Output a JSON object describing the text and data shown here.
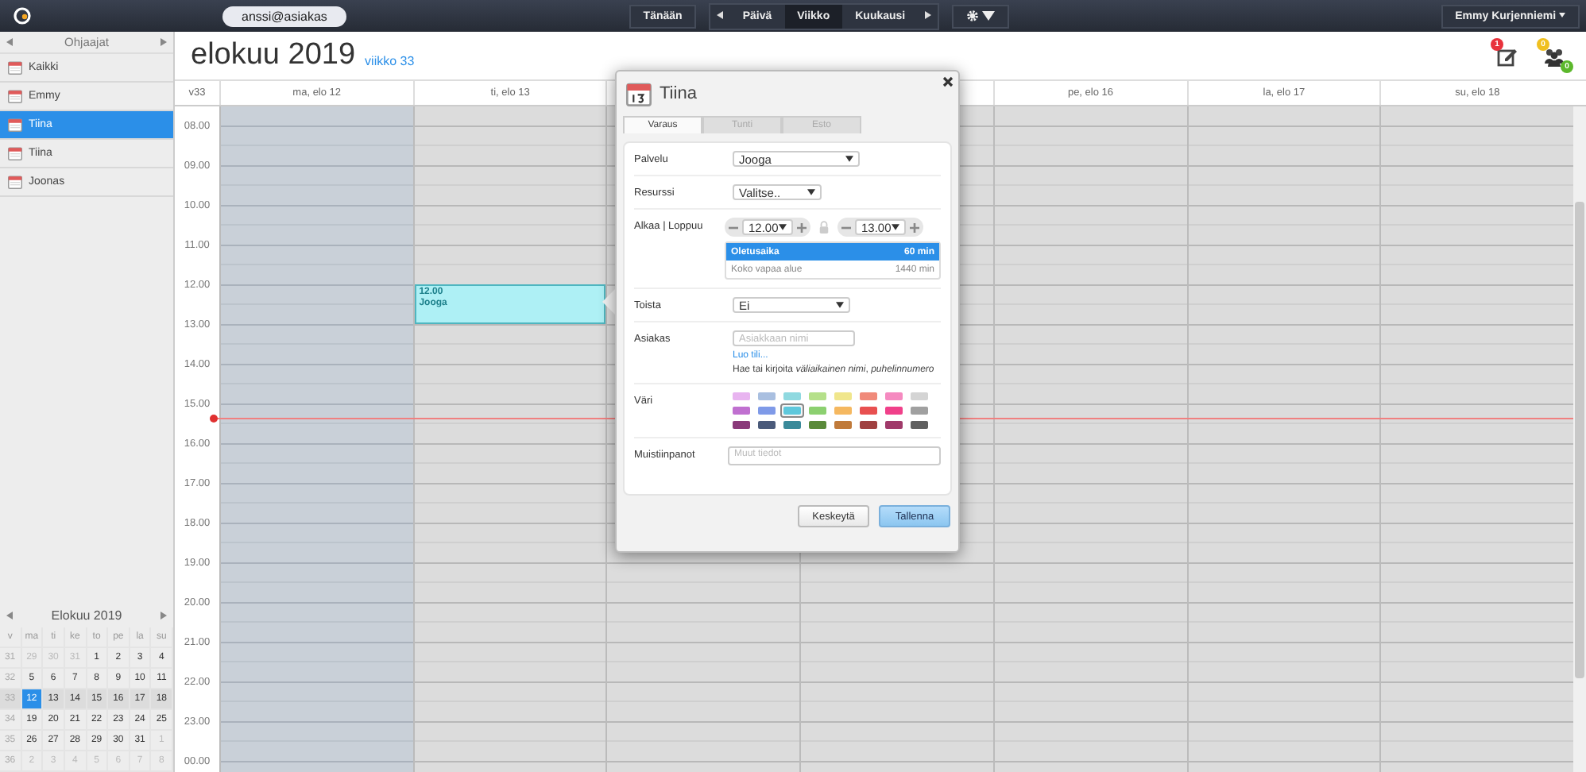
{
  "topbar": {
    "account": "anssi@asiakas",
    "today_button": "Tänään",
    "views": [
      {
        "label": "Päivä",
        "selected": false
      },
      {
        "label": "Viikko",
        "selected": true
      },
      {
        "label": "Kuukausi",
        "selected": false
      }
    ],
    "user_menu": "Emmy Kurjenniemi"
  },
  "sidebar": {
    "title": "Ohjaajat",
    "items": [
      {
        "label": "Kaikki",
        "selected": false
      },
      {
        "label": "Emmy",
        "selected": false
      },
      {
        "label": "Tiina",
        "selected": true
      },
      {
        "label": "Tiina",
        "selected": false
      },
      {
        "label": "Joonas",
        "selected": false
      }
    ]
  },
  "mini_calendar": {
    "title": "Elokuu 2019",
    "weekdays": [
      "v",
      "ma",
      "ti",
      "ke",
      "to",
      "pe",
      "la",
      "su"
    ],
    "weeks": [
      {
        "number": "31",
        "current": false,
        "days": [
          {
            "label": "29",
            "other_month": true,
            "selected": false
          },
          {
            "label": "30",
            "other_month": true,
            "selected": false
          },
          {
            "label": "31",
            "other_month": true,
            "selected": false
          },
          {
            "label": "1",
            "other_month": false,
            "selected": false
          },
          {
            "label": "2",
            "other_month": false,
            "selected": false
          },
          {
            "label": "3",
            "other_month": false,
            "selected": false
          },
          {
            "label": "4",
            "other_month": false,
            "selected": false
          }
        ]
      },
      {
        "number": "32",
        "current": false,
        "days": [
          {
            "label": "5",
            "other_month": false,
            "selected": false
          },
          {
            "label": "6",
            "other_month": false,
            "selected": false
          },
          {
            "label": "7",
            "other_month": false,
            "selected": false
          },
          {
            "label": "8",
            "other_month": false,
            "selected": false
          },
          {
            "label": "9",
            "other_month": false,
            "selected": false
          },
          {
            "label": "10",
            "other_month": false,
            "selected": false
          },
          {
            "label": "11",
            "other_month": false,
            "selected": false
          }
        ]
      },
      {
        "number": "33",
        "current": true,
        "days": [
          {
            "label": "12",
            "other_month": false,
            "selected": true
          },
          {
            "label": "13",
            "other_month": false,
            "selected": false
          },
          {
            "label": "14",
            "other_month": false,
            "selected": false
          },
          {
            "label": "15",
            "other_month": false,
            "selected": false
          },
          {
            "label": "16",
            "other_month": false,
            "selected": false
          },
          {
            "label": "17",
            "other_month": false,
            "selected": false
          },
          {
            "label": "18",
            "other_month": false,
            "selected": false
          }
        ]
      },
      {
        "number": "34",
        "current": false,
        "days": [
          {
            "label": "19",
            "other_month": false,
            "selected": false
          },
          {
            "label": "20",
            "other_month": false,
            "selected": false
          },
          {
            "label": "21",
            "other_month": false,
            "selected": false
          },
          {
            "label": "22",
            "other_month": false,
            "selected": false
          },
          {
            "label": "23",
            "other_month": false,
            "selected": false
          },
          {
            "label": "24",
            "other_month": false,
            "selected": false
          },
          {
            "label": "25",
            "other_month": false,
            "selected": false
          }
        ]
      },
      {
        "number": "35",
        "current": false,
        "days": [
          {
            "label": "26",
            "other_month": false,
            "selected": false
          },
          {
            "label": "27",
            "other_month": false,
            "selected": false
          },
          {
            "label": "28",
            "other_month": false,
            "selected": false
          },
          {
            "label": "29",
            "other_month": false,
            "selected": false
          },
          {
            "label": "30",
            "other_month": false,
            "selected": false
          },
          {
            "label": "31",
            "other_month": false,
            "selected": false
          },
          {
            "label": "1",
            "other_month": true,
            "selected": false
          }
        ]
      },
      {
        "number": "36",
        "current": false,
        "days": [
          {
            "label": "2",
            "other_month": true,
            "selected": false
          },
          {
            "label": "3",
            "other_month": true,
            "selected": false
          },
          {
            "label": "4",
            "other_month": true,
            "selected": false
          },
          {
            "label": "5",
            "other_month": true,
            "selected": false
          },
          {
            "label": "6",
            "other_month": true,
            "selected": false
          },
          {
            "label": "7",
            "other_month": true,
            "selected": false
          },
          {
            "label": "8",
            "other_month": true,
            "selected": false
          }
        ]
      }
    ]
  },
  "calendar": {
    "title": "elokuu 2019",
    "week_link": "viikko 33",
    "notes_badge": "1",
    "group_badges": [
      "0",
      "0"
    ],
    "week_label": "v33",
    "days": [
      {
        "label": "ma, elo 12",
        "selected": true
      },
      {
        "label": "ti, elo 13",
        "selected": false,
        "events": [
          {
            "start": "12.00",
            "title": "Jooga"
          }
        ]
      },
      {
        "selected": false
      },
      {
        "selected": false
      },
      {
        "label": "pe, elo 16",
        "selected": false
      },
      {
        "label": "la, elo 17",
        "selected": false
      },
      {
        "label": "su, elo 18",
        "selected": false
      }
    ],
    "hours": [
      "08.00",
      "09.00",
      "10.00",
      "11.00",
      "12.00",
      "13.00",
      "14.00",
      "15.00",
      "16.00",
      "17.00",
      "18.00",
      "19.00",
      "20.00",
      "21.00",
      "22.00",
      "23.00",
      "00.00"
    ]
  },
  "dialog": {
    "title": "Tiina",
    "tabs": [
      {
        "label": "Varaus",
        "selected": true
      },
      {
        "label": "Tunti",
        "selected": false
      },
      {
        "label": "Esto",
        "selected": false
      }
    ],
    "fields": [
      {
        "kind": "select",
        "label": "Palvelu",
        "value": "Jooga"
      },
      {
        "kind": "select",
        "label": "Resurssi",
        "value": "Valitse.."
      },
      {
        "kind": "time",
        "label": "Alkaa | Loppuu",
        "start": "12.00",
        "end": "13.00",
        "options": [
          {
            "label": "Oletusaika",
            "duration": "60 min",
            "selected": true
          },
          {
            "label": "Koko vapaa alue",
            "duration": "1440 min",
            "selected": false
          }
        ]
      },
      {
        "kind": "select",
        "label": "Toista",
        "value": "Ei"
      },
      {
        "kind": "customer",
        "label": "Asiakas",
        "placeholder": "Asiakkaan nimi",
        "link": "Luo tili...",
        "hint": "Hae tai kirjoita *väliaikainen nimi*, *puhelinnumero*"
      },
      {
        "kind": "colors",
        "label": "Väri",
        "colors": [
          {
            "color": "#e8b4f0",
            "selected": false
          },
          {
            "color": "#a9bfe0",
            "selected": false
          },
          {
            "color": "#8fd9e0",
            "selected": false
          },
          {
            "color": "#b5e08a",
            "selected": false
          },
          {
            "color": "#f0e68c",
            "selected": false
          },
          {
            "color": "#f08a7a",
            "selected": false
          },
          {
            "color": "#f58ac0",
            "selected": false
          },
          {
            "color": "#d4d4d4",
            "selected": false
          },
          {
            "color": "#c070d0",
            "selected": false
          },
          {
            "color": "#7f9ae8",
            "selected": false
          },
          {
            "color": "#5ec8dc",
            "selected": true
          },
          {
            "color": "#8cd070",
            "selected": false
          },
          {
            "color": "#f5b860",
            "selected": false
          },
          {
            "color": "#e85050",
            "selected": false
          },
          {
            "color": "#f0408a",
            "selected": false
          },
          {
            "color": "#a0a0a0",
            "selected": false
          },
          {
            "color": "#8a3a7a",
            "selected": false
          },
          {
            "color": "#4a5a7a",
            "selected": false
          },
          {
            "color": "#3a8a9a",
            "selected": false
          },
          {
            "color": "#5a8a3a",
            "selected": false
          },
          {
            "color": "#c07a3a",
            "selected": false
          },
          {
            "color": "#a04040",
            "selected": false
          },
          {
            "color": "#a03a6a",
            "selected": false
          },
          {
            "color": "#606060",
            "selected": false
          }
        ]
      },
      {
        "kind": "textarea",
        "label": "Muistiinpanot",
        "placeholder": "Muut tiedot"
      }
    ],
    "buttons": [
      {
        "label": "Keskeytä",
        "kind": "secondary"
      },
      {
        "label": "Tallenna",
        "kind": "primary"
      }
    ]
  }
}
